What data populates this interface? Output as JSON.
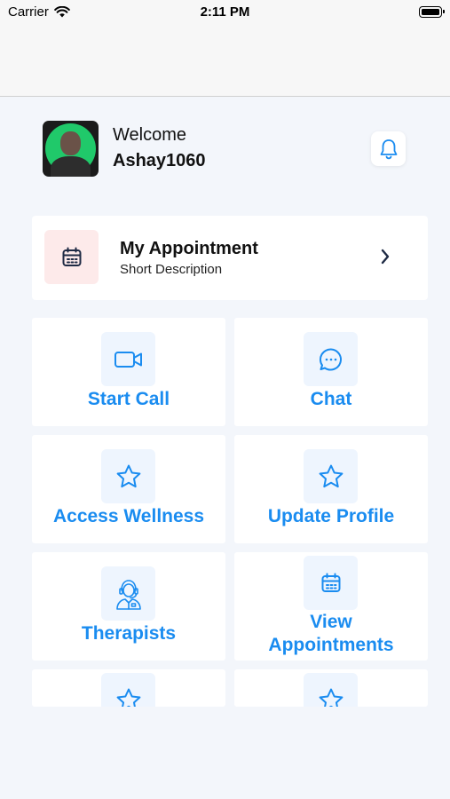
{
  "status_bar": {
    "carrier": "Carrier",
    "time": "2:11 PM"
  },
  "header": {
    "welcome_text": "Welcome",
    "username": "Ashay1060"
  },
  "appointment_card": {
    "title": "My Appointment",
    "description": "Short Description"
  },
  "tiles": [
    {
      "label": "Start Call",
      "icon": "video-camera-icon"
    },
    {
      "label": "Chat",
      "icon": "chat-bubble-icon"
    },
    {
      "label": "Access Wellness",
      "icon": "star-icon"
    },
    {
      "label": "Update Profile",
      "icon": "star-icon"
    },
    {
      "label": "Therapists",
      "icon": "therapist-icon"
    },
    {
      "label_line1": "View",
      "label_line2": "Appointments",
      "icon": "calendar-icon"
    },
    {
      "label": "",
      "icon": "star-icon"
    },
    {
      "label": "",
      "icon": "star-icon"
    }
  ],
  "colors": {
    "accent": "#1a8cf0",
    "icon_tile_bg": "#eef5fe",
    "appointment_icon_bg": "#fdeaea",
    "page_bg": "#f3f6fb",
    "avatar_ring": "#20c96a"
  }
}
